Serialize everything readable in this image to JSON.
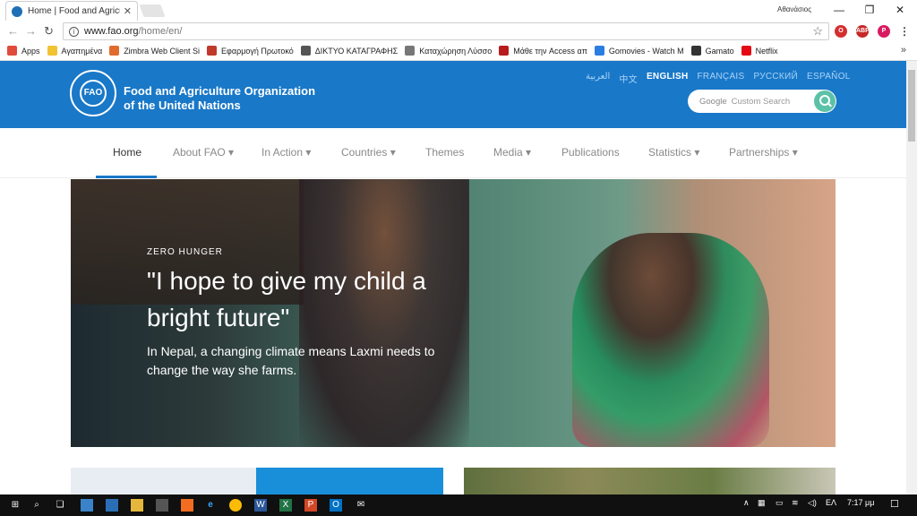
{
  "browser": {
    "tab_title": "Home | Food and Agricu",
    "profile_name": "Αθανάσιος",
    "url_host": "www.fao.org",
    "url_path": "/home/en/",
    "bookmarks": [
      {
        "label": "Apps",
        "color": "#e14b3b"
      },
      {
        "label": "Αγαπημένα",
        "color": "#f1c232"
      },
      {
        "label": "Zimbra Web Client Si",
        "color": "#e06b2d"
      },
      {
        "label": "Εφαρμογή Πρωτοκό",
        "color": "#c0392b"
      },
      {
        "label": "ΔΙΚΤΥΟ ΚΑΤΑΓΡΑΦΗΣ",
        "color": "#555555"
      },
      {
        "label": "Καταχώρηση Λύσσο",
        "color": "#777777"
      },
      {
        "label": "Μάθε την Access απ",
        "color": "#b71c1c"
      },
      {
        "label": "Gomovies - Watch M",
        "color": "#2b7de1"
      },
      {
        "label": "Gamato",
        "color": "#333333"
      },
      {
        "label": "Netflix",
        "color": "#e50914"
      }
    ]
  },
  "site": {
    "org_line1": "Food and Agriculture Organization",
    "org_line2": "of the United Nations",
    "logo_text": "FAO",
    "languages": [
      "العربية",
      "中文",
      "ENGLISH",
      "FRANÇAIS",
      "РУССКИЙ",
      "ESPAÑOL"
    ],
    "active_language": "ENGLISH",
    "search_brand": "Google",
    "search_placeholder": "Custom Search",
    "nav": [
      "Home",
      "About FAO ▾",
      "In Action ▾",
      "Countries ▾",
      "Themes",
      "Media ▾",
      "Publications",
      "Statistics ▾",
      "Partnerships ▾"
    ],
    "hero": {
      "kicker": "ZERO HUNGER",
      "headline": "\"I hope to give my child a bright future\"",
      "sub": "In Nepal, a changing climate means Laxmi needs to change the way she farms."
    }
  },
  "taskbar": {
    "lang": "ΕΛ",
    "time": "7:17 μμ"
  },
  "colors": {
    "header_blue": "#1978c8",
    "search_button": "#5cc2a7"
  }
}
